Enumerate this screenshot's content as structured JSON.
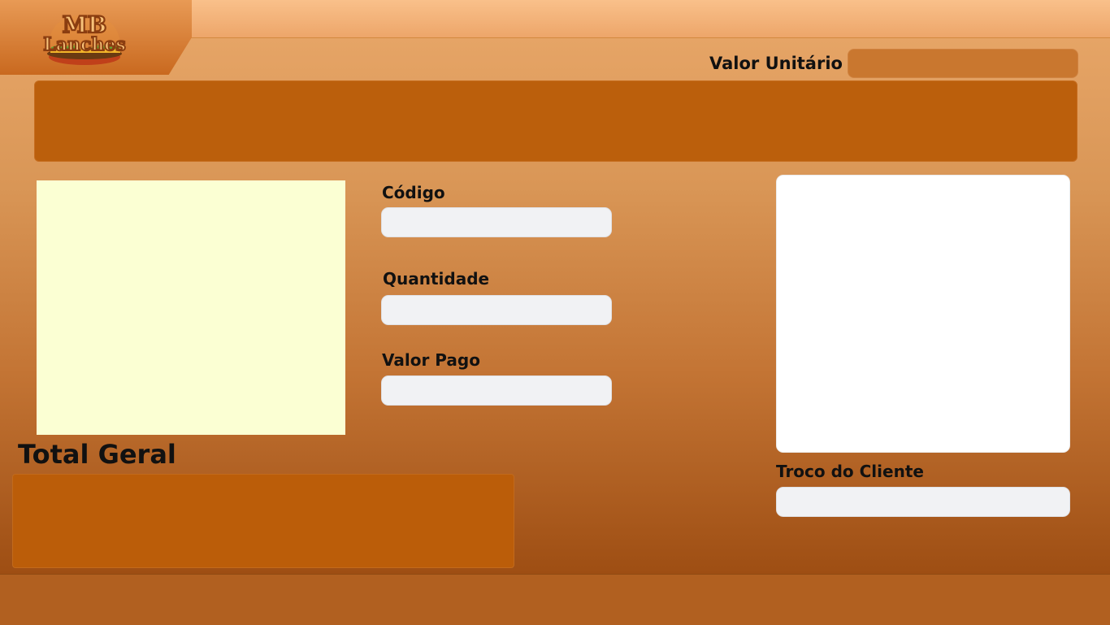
{
  "brand": {
    "logo_line1": "MB",
    "logo_line2": "Lanches"
  },
  "fields": {
    "valor_unitario_label": "Valor Unitário",
    "codigo_label": "Código",
    "quantidade_label": "Quantidade",
    "valor_pago_label": "Valor Pago",
    "troco_label": "Troco do Cliente",
    "total_label": "Total Geral"
  },
  "colors": {
    "accent": "#bb5f0c",
    "image_placeholder": "#fbffd3",
    "input_bg": "#f1f2f4"
  }
}
